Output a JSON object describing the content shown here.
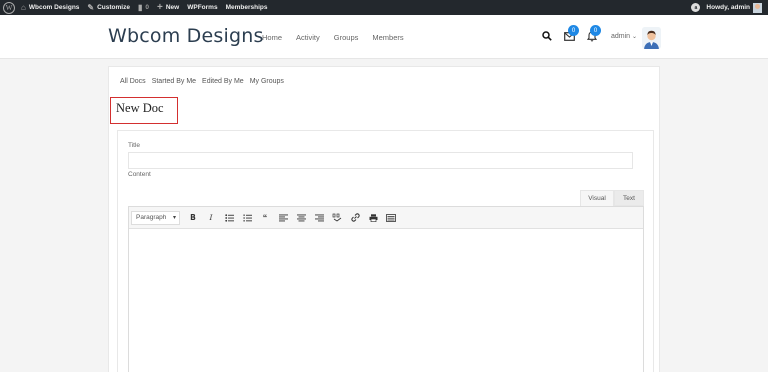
{
  "adminbar": {
    "site_name": "Wbcom Designs",
    "customize": "Customize",
    "comments_count": "0",
    "new": "New",
    "wpforms": "WPForms",
    "memberships": "Memberships",
    "howdy": "Howdy, admin",
    "circle_label": "a"
  },
  "header": {
    "logo": "Wbcom Designs",
    "nav": [
      "Home",
      "Activity",
      "Groups",
      "Members"
    ],
    "messages_count": "0",
    "notifications_count": "0",
    "user_name": "admin"
  },
  "subnav": [
    "All Docs",
    "Started By Me",
    "Edited By Me",
    "My Groups"
  ],
  "page_title": "New Doc",
  "form": {
    "title_label": "Title",
    "title_value": "",
    "content_label": "Content",
    "tab_visual": "Visual",
    "tab_text": "Text",
    "format_select": "Paragraph"
  }
}
